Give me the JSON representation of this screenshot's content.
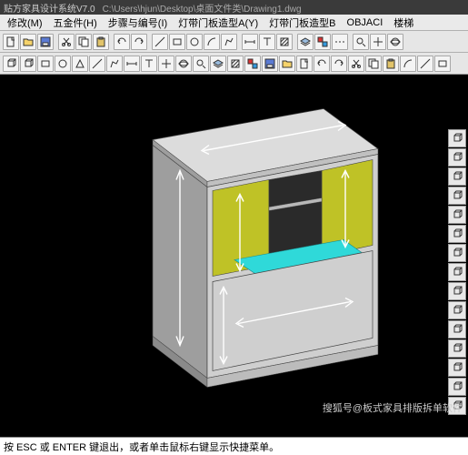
{
  "titlebar": {
    "app_name": "贴方家具设计系统V7.0",
    "doc_path": "C:\\Users\\hjun\\Desktop\\桌面文件类\\Drawing1.dwg"
  },
  "menubar": {
    "items": [
      {
        "label": "修改(M)"
      },
      {
        "label": "五金件(H)"
      },
      {
        "label": "步骤与编号(I)"
      },
      {
        "label": "灯带门板造型A(Y)"
      },
      {
        "label": "灯带门板造型B"
      },
      {
        "label": "OBJACI"
      },
      {
        "label": "楼梯"
      }
    ]
  },
  "toolbar_row1": {
    "buttons": [
      {
        "name": "tool-new",
        "icon": "doc"
      },
      {
        "name": "tool-open",
        "icon": "folder"
      },
      {
        "name": "tool-save",
        "icon": "disk"
      },
      {
        "name": "tool-sep"
      },
      {
        "name": "tool-cut",
        "icon": "cut"
      },
      {
        "name": "tool-copy",
        "icon": "copy"
      },
      {
        "name": "tool-paste",
        "icon": "paste"
      },
      {
        "name": "tool-sep"
      },
      {
        "name": "tool-undo",
        "icon": "undo"
      },
      {
        "name": "tool-redo",
        "icon": "redo"
      },
      {
        "name": "tool-sep"
      },
      {
        "name": "tool-line",
        "icon": "line"
      },
      {
        "name": "tool-rect",
        "icon": "rect"
      },
      {
        "name": "tool-circle",
        "icon": "circle"
      },
      {
        "name": "tool-arc",
        "icon": "arc"
      },
      {
        "name": "tool-poly",
        "icon": "poly"
      },
      {
        "name": "tool-sep"
      },
      {
        "name": "tool-dim",
        "icon": "dim"
      },
      {
        "name": "tool-text",
        "icon": "text"
      },
      {
        "name": "tool-hatch",
        "icon": "hatch"
      },
      {
        "name": "tool-sep"
      },
      {
        "name": "tool-layer",
        "icon": "layer"
      },
      {
        "name": "tool-color",
        "icon": "color"
      },
      {
        "name": "tool-ltype",
        "icon": "ltype"
      },
      {
        "name": "tool-sep"
      },
      {
        "name": "tool-zoom",
        "icon": "zoom"
      },
      {
        "name": "tool-pan",
        "icon": "pan"
      },
      {
        "name": "tool-orbit",
        "icon": "orbit"
      }
    ]
  },
  "toolbar_row2": {
    "buttons": [
      {
        "name": "tool2-a",
        "icon": "box"
      },
      {
        "name": "tool2-b",
        "icon": "box"
      },
      {
        "name": "tool2-c",
        "icon": "rect"
      },
      {
        "name": "tool2-d",
        "icon": "circle"
      },
      {
        "name": "tool2-e",
        "icon": "tri"
      },
      {
        "name": "tool2-f",
        "icon": "line"
      },
      {
        "name": "tool2-g",
        "icon": "poly"
      },
      {
        "name": "tool2-h",
        "icon": "dim"
      },
      {
        "name": "tool2-i",
        "icon": "text"
      },
      {
        "name": "tool2-j",
        "icon": "pan"
      },
      {
        "name": "tool2-k",
        "icon": "orbit"
      },
      {
        "name": "tool2-l",
        "icon": "zoom"
      },
      {
        "name": "tool2-m",
        "icon": "layer"
      },
      {
        "name": "tool2-n",
        "icon": "hatch"
      },
      {
        "name": "tool2-o",
        "icon": "color"
      },
      {
        "name": "tool2-p",
        "icon": "disk"
      },
      {
        "name": "tool2-q",
        "icon": "folder"
      },
      {
        "name": "tool2-r",
        "icon": "doc"
      },
      {
        "name": "tool2-s",
        "icon": "undo"
      },
      {
        "name": "tool2-t",
        "icon": "redo"
      },
      {
        "name": "tool2-u",
        "icon": "cut"
      },
      {
        "name": "tool2-v",
        "icon": "copy"
      },
      {
        "name": "tool2-w",
        "icon": "paste"
      },
      {
        "name": "tool2-x",
        "icon": "arc"
      },
      {
        "name": "tool2-y",
        "icon": "line"
      },
      {
        "name": "tool2-z",
        "icon": "rect"
      }
    ]
  },
  "palette_right": {
    "buttons": [
      {
        "name": "view-top"
      },
      {
        "name": "view-front"
      },
      {
        "name": "view-left"
      },
      {
        "name": "view-right"
      },
      {
        "name": "view-iso-ne"
      },
      {
        "name": "view-iso-nw"
      },
      {
        "name": "view-iso-se"
      },
      {
        "name": "view-iso-sw"
      },
      {
        "name": "view-wire"
      },
      {
        "name": "view-shade"
      },
      {
        "name": "view-hidden"
      },
      {
        "name": "view-zoom-ext"
      },
      {
        "name": "view-zoom-win"
      },
      {
        "name": "view-pan"
      },
      {
        "name": "view-orbit"
      }
    ]
  },
  "command": {
    "hint": "按 ESC 或 ENTER 键退出，或者单击鼠标右键显示快捷菜单。",
    "current": "3DORBIT"
  },
  "watermark": {
    "text": "搜狐号@板式家具排版拆单软件"
  },
  "model": {
    "colors": {
      "body": "#cfcfcf",
      "body_shadow": "#9e9e9e",
      "door": "#bfc226",
      "door_shadow": "#9a9e1e",
      "shelf": "#2fd9d9",
      "edge": "#3a3a3a",
      "arrow": "#ffffff"
    }
  }
}
